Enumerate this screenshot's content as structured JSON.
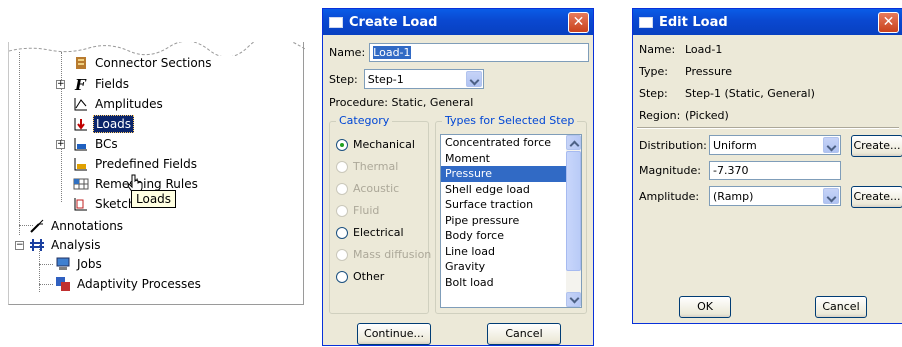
{
  "tree": {
    "items": [
      {
        "label": "Connector Sections"
      },
      {
        "label": "Fields"
      },
      {
        "label": "Amplitudes"
      },
      {
        "label": "Loads"
      },
      {
        "label": "BCs"
      },
      {
        "label": "Predefined Fields"
      },
      {
        "label": "Remeshing Rules"
      },
      {
        "label": "Sketches"
      },
      {
        "label": "Annotations"
      },
      {
        "label": "Analysis"
      },
      {
        "label": "Jobs"
      },
      {
        "label": "Adaptivity Processes"
      }
    ],
    "tooltip": "Loads"
  },
  "create_load": {
    "title": "Create Load",
    "name_label": "Name:",
    "name_value": "Load-1",
    "step_label": "Step:",
    "step_value": "Step-1",
    "procedure_text": "Procedure:  Static, General",
    "category_title": "Category",
    "categories": [
      {
        "label": "Mechanical",
        "selected": true,
        "enabled": true
      },
      {
        "label": "Thermal",
        "selected": false,
        "enabled": false
      },
      {
        "label": "Acoustic",
        "selected": false,
        "enabled": false
      },
      {
        "label": "Fluid",
        "selected": false,
        "enabled": false
      },
      {
        "label": "Electrical",
        "selected": false,
        "enabled": true
      },
      {
        "label": "Mass diffusion",
        "selected": false,
        "enabled": false
      },
      {
        "label": "Other",
        "selected": false,
        "enabled": true
      }
    ],
    "types_title": "Types for Selected Step",
    "types": [
      {
        "label": "Concentrated force",
        "selected": false
      },
      {
        "label": "Moment",
        "selected": false
      },
      {
        "label": "Pressure",
        "selected": true
      },
      {
        "label": "Shell edge load",
        "selected": false
      },
      {
        "label": "Surface traction",
        "selected": false
      },
      {
        "label": "Pipe pressure",
        "selected": false
      },
      {
        "label": "Body force",
        "selected": false
      },
      {
        "label": "Line load",
        "selected": false
      },
      {
        "label": "Gravity",
        "selected": false
      },
      {
        "label": "Bolt load",
        "selected": false
      }
    ],
    "continue_label": "Continue...",
    "cancel_label": "Cancel"
  },
  "edit_load": {
    "title": "Edit Load",
    "info": [
      {
        "label": "Name:",
        "value": "Load-1"
      },
      {
        "label": "Type:",
        "value": "Pressure"
      },
      {
        "label": "Step:",
        "value": "Step-1 (Static, General)"
      },
      {
        "label": "Region:",
        "value": "(Picked)"
      }
    ],
    "distribution_label": "Distribution:",
    "distribution_value": "Uniform",
    "magnitude_label": "Magnitude:",
    "magnitude_value": "-7.370",
    "amplitude_label": "Amplitude:",
    "amplitude_value": "(Ramp)",
    "create_label": "Create...",
    "ok_label": "OK",
    "cancel_label": "Cancel"
  },
  "colors": {
    "title_bar": "#0a48d0",
    "dialog_bg": "#ece9d8",
    "selection": "#316ac5",
    "tree_selection": "#0a246a",
    "group_title": "#0046d5"
  }
}
